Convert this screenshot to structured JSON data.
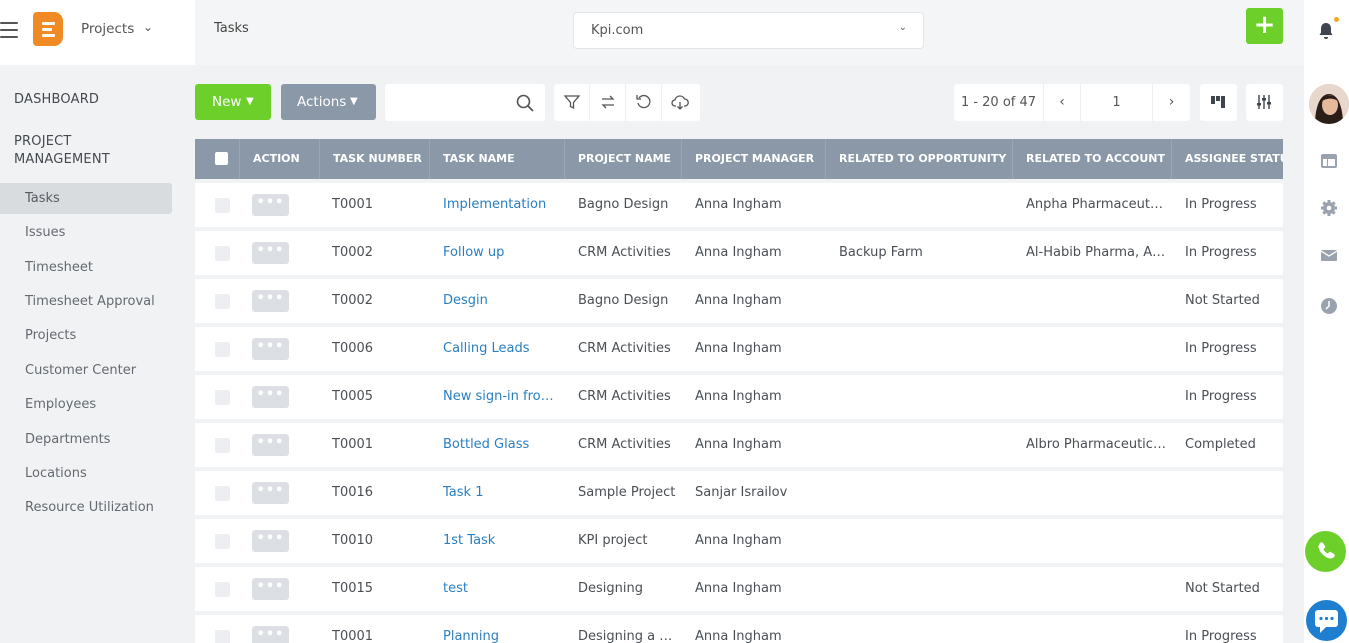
{
  "header": {
    "app_switcher": "Projects",
    "breadcrumb": "Tasks",
    "company": "Kpi.com",
    "add_label": "+"
  },
  "sidebar": {
    "sections": [
      {
        "label": "DASHBOARD"
      },
      {
        "label": "PROJECT MANAGEMENT"
      }
    ],
    "items": [
      {
        "label": "Tasks",
        "active": true
      },
      {
        "label": "Issues"
      },
      {
        "label": "Timesheet"
      },
      {
        "label": "Timesheet Approval"
      },
      {
        "label": "Projects"
      },
      {
        "label": "Customer Center"
      },
      {
        "label": "Employees"
      },
      {
        "label": "Departments"
      },
      {
        "label": "Locations"
      },
      {
        "label": "Resource Utilization"
      }
    ]
  },
  "toolbar": {
    "new_label": "New",
    "actions_label": "Actions",
    "search_placeholder": "",
    "pager_range": "1 - 20 of 47",
    "current_page": "1"
  },
  "table": {
    "columns": [
      "ACTION",
      "TASK NUMBER",
      "TASK NAME",
      "PROJECT NAME",
      "PROJECT MANAGER",
      "RELATED TO OPPORTUNITY",
      "RELATED TO ACCOUNT",
      "ASSIGNEE STATUS"
    ],
    "rows": [
      {
        "number": "T0001",
        "name": "Implementation",
        "project": "Bagno Design",
        "manager": "Anna Ingham",
        "opportunity": "",
        "account": "Anpha Pharmaceutic...",
        "status": "In Progress"
      },
      {
        "number": "T0002",
        "name": "Follow up",
        "project": "CRM Activities",
        "manager": "Anna Ingham",
        "opportunity": "Backup Farm",
        "account": "Al-Habib Pharma, Al-...",
        "status": "In Progress"
      },
      {
        "number": "T0002",
        "name": "Desgin",
        "project": "Bagno Design",
        "manager": "Anna Ingham",
        "opportunity": "",
        "account": "",
        "status": "Not Started"
      },
      {
        "number": "T0006",
        "name": "Calling Leads",
        "project": "CRM Activities",
        "manager": "Anna Ingham",
        "opportunity": "",
        "account": "",
        "status": "In Progress"
      },
      {
        "number": "T0005",
        "name": "New sign-in from ...",
        "project": "CRM Activities",
        "manager": "Anna Ingham",
        "opportunity": "",
        "account": "",
        "status": "In Progress"
      },
      {
        "number": "T0001",
        "name": "Bottled Glass",
        "project": "CRM Activities",
        "manager": "Anna Ingham",
        "opportunity": "",
        "account": "Albro Pharmaceutical ...",
        "status": "Completed"
      },
      {
        "number": "T0016",
        "name": "Task 1",
        "project": "Sample Project",
        "manager": "Sanjar Israilov",
        "opportunity": "",
        "account": "",
        "status": ""
      },
      {
        "number": "T0010",
        "name": "1st Task",
        "project": "KPI project",
        "manager": "Anna Ingham",
        "opportunity": "",
        "account": "",
        "status": ""
      },
      {
        "number": "T0015",
        "name": "test",
        "project": "Designing",
        "manager": "Anna Ingham",
        "opportunity": "",
        "account": "",
        "status": "Not Started"
      },
      {
        "number": "T0001",
        "name": "Planning",
        "project": "Designing a w...",
        "manager": "Anna Ingham",
        "opportunity": "",
        "account": "",
        "status": "In Progress"
      }
    ]
  },
  "colors": {
    "accent_green": "#6ccf2a",
    "header_gray": "#8a98a8",
    "link_blue": "#2a7fc1",
    "logo_orange": "#f08a24"
  }
}
